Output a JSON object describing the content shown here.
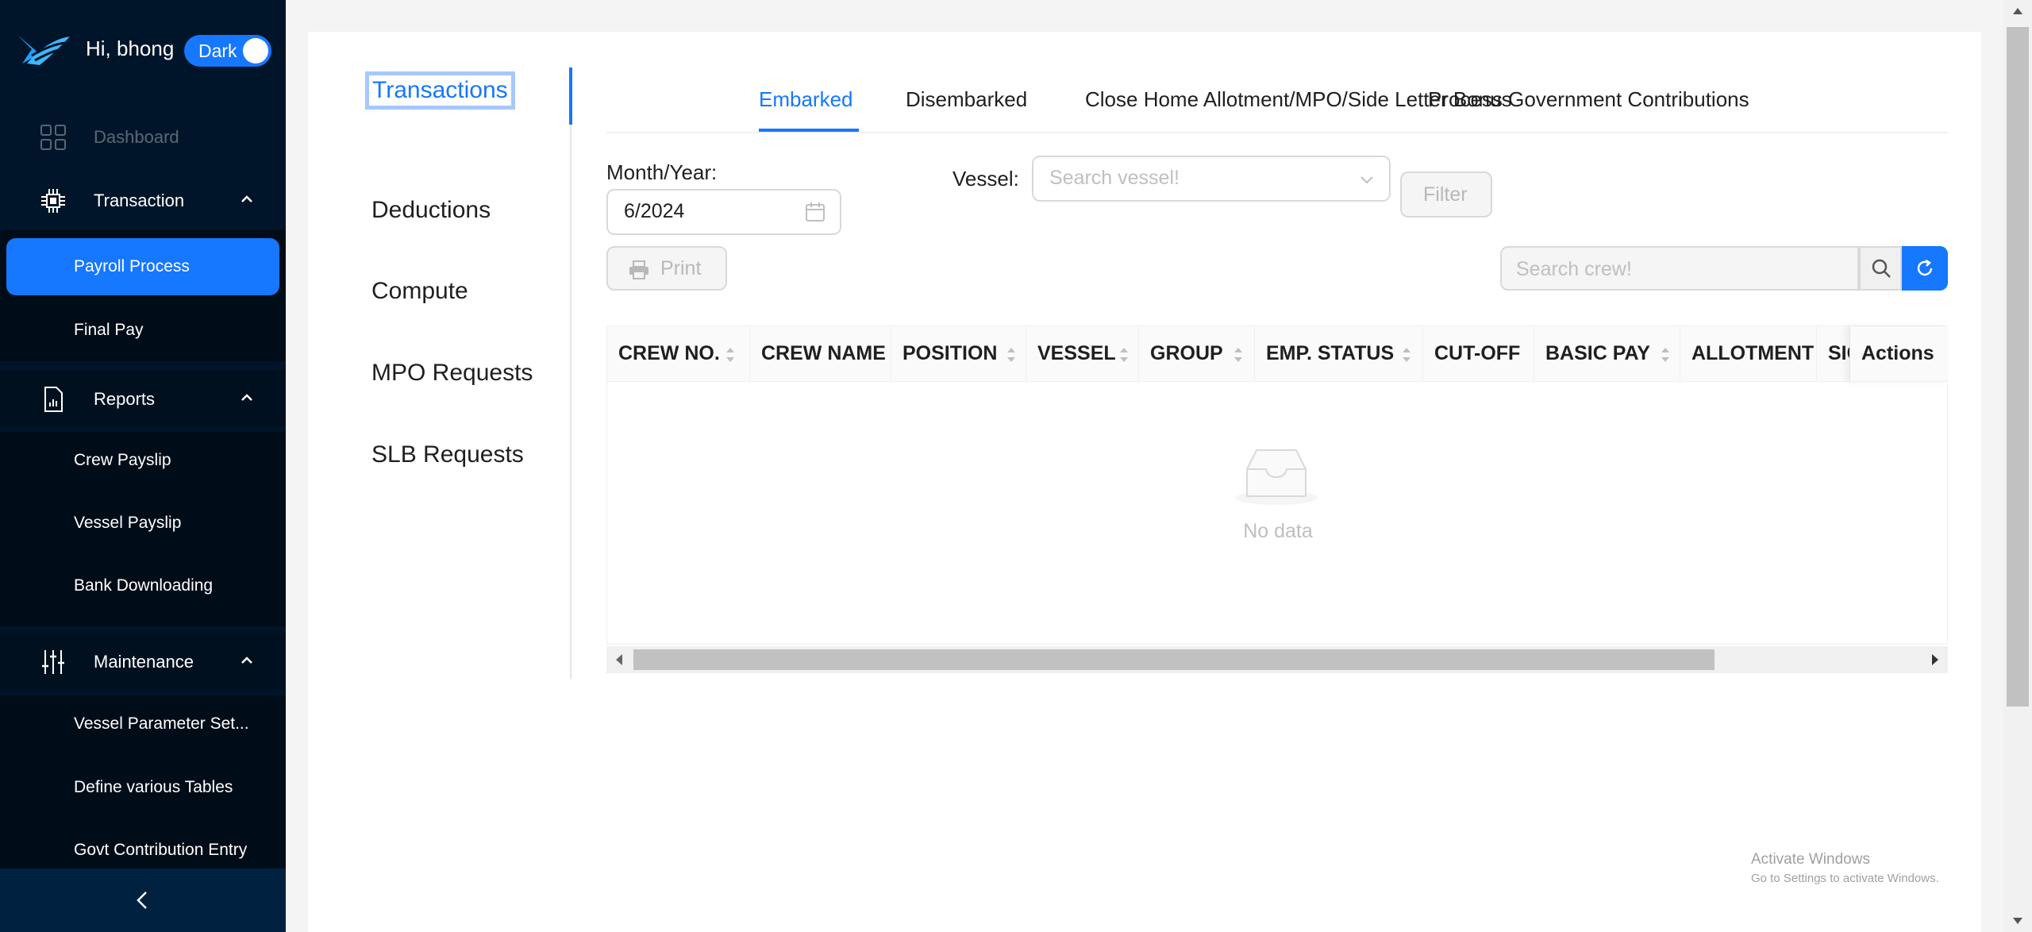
{
  "header": {
    "greeting": "Hi, bhong",
    "theme_toggle_label": "Dark"
  },
  "sidebar": {
    "dashboard": "Dashboard",
    "transaction": "Transaction",
    "transaction_items": [
      "Payroll Process",
      "Final Pay"
    ],
    "reports": "Reports",
    "report_items": [
      "Crew Payslip",
      "Vessel Payslip",
      "Bank Downloading"
    ],
    "maintenance": "Maintenance",
    "maintenance_items": [
      "Vessel Parameter Set...",
      "Define various Tables",
      "Govt Contribution Entry"
    ]
  },
  "vertical_tabs": [
    "Transactions",
    "Deductions",
    "Compute",
    "MPO Requests",
    "SLB Requests"
  ],
  "tabs": [
    "Embarked",
    "Disembarked",
    "Close Home Allotment/MPO/Side Letter Bonus",
    "Process Government Contributions"
  ],
  "filters": {
    "month_year_label": "Month/Year:",
    "month_year_value": "6/2024",
    "vessel_label": "Vessel:",
    "vessel_placeholder": "Search vessel!",
    "filter_button": "Filter",
    "print_button": "Print",
    "crew_search_placeholder": "Search crew!"
  },
  "table": {
    "columns": [
      "CREW NO.",
      "CREW NAME",
      "POSITION",
      "VESSEL",
      "GROUP",
      "EMP. STATUS",
      "CUT-OFF",
      "BASIC PAY",
      "ALLOTMENT",
      "SIG",
      "Actions"
    ],
    "empty_text": "No data"
  },
  "watermark": {
    "title": "Activate Windows",
    "subtitle": "Go to Settings to activate Windows."
  },
  "colors": {
    "sidebar": "#001529",
    "primary": "#1677ff"
  }
}
